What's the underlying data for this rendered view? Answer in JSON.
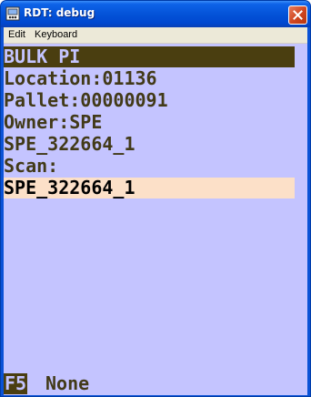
{
  "window": {
    "title": "RDT: debug"
  },
  "menu": {
    "items": [
      "Edit",
      "Keyboard"
    ]
  },
  "screen": {
    "header": "BULK PI",
    "location": "Location:01136",
    "pallet": "Pallet:00000091",
    "owner": "Owner:SPE",
    "item_id": "SPE_322664_1",
    "scan_label": "Scan:",
    "scan_value": "SPE_322664_1"
  },
  "footer": {
    "function_key": "F5",
    "function_label": "None"
  },
  "colors": {
    "screen_background": "#c4c4ff",
    "text": "#423a18",
    "header_background": "#4a3e10",
    "input_background": "#fce0c8",
    "titlebar": "#0453d8"
  }
}
